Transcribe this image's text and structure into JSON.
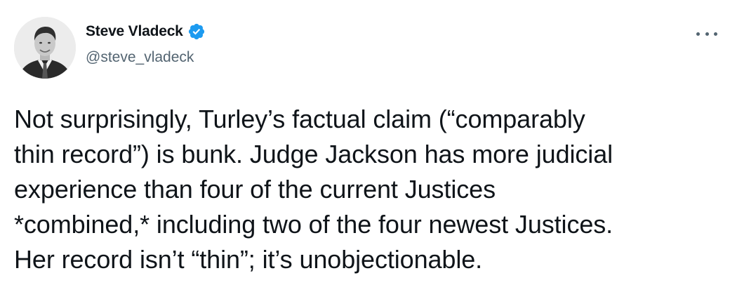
{
  "tweet": {
    "author": {
      "display_name": "Steve Vladeck",
      "handle": "@steve_vladeck",
      "verified": true,
      "avatar_icon": "profile-photo",
      "verified_icon": "verified-badge-icon"
    },
    "more_icon": "more-options-icon",
    "text": "Not surprisingly, Turley’s factual claim (“comparably\nthin record”) is bunk. Judge Jackson has more judicial\nexperience than four of the current Justices\n*combined,* including two of the four newest Justices.\nHer record isn’t “thin”; it’s unobjectionable."
  },
  "colors": {
    "text_primary": "#0f1419",
    "text_secondary": "#536471",
    "verified_blue": "#1d9bf0",
    "background": "#ffffff"
  }
}
